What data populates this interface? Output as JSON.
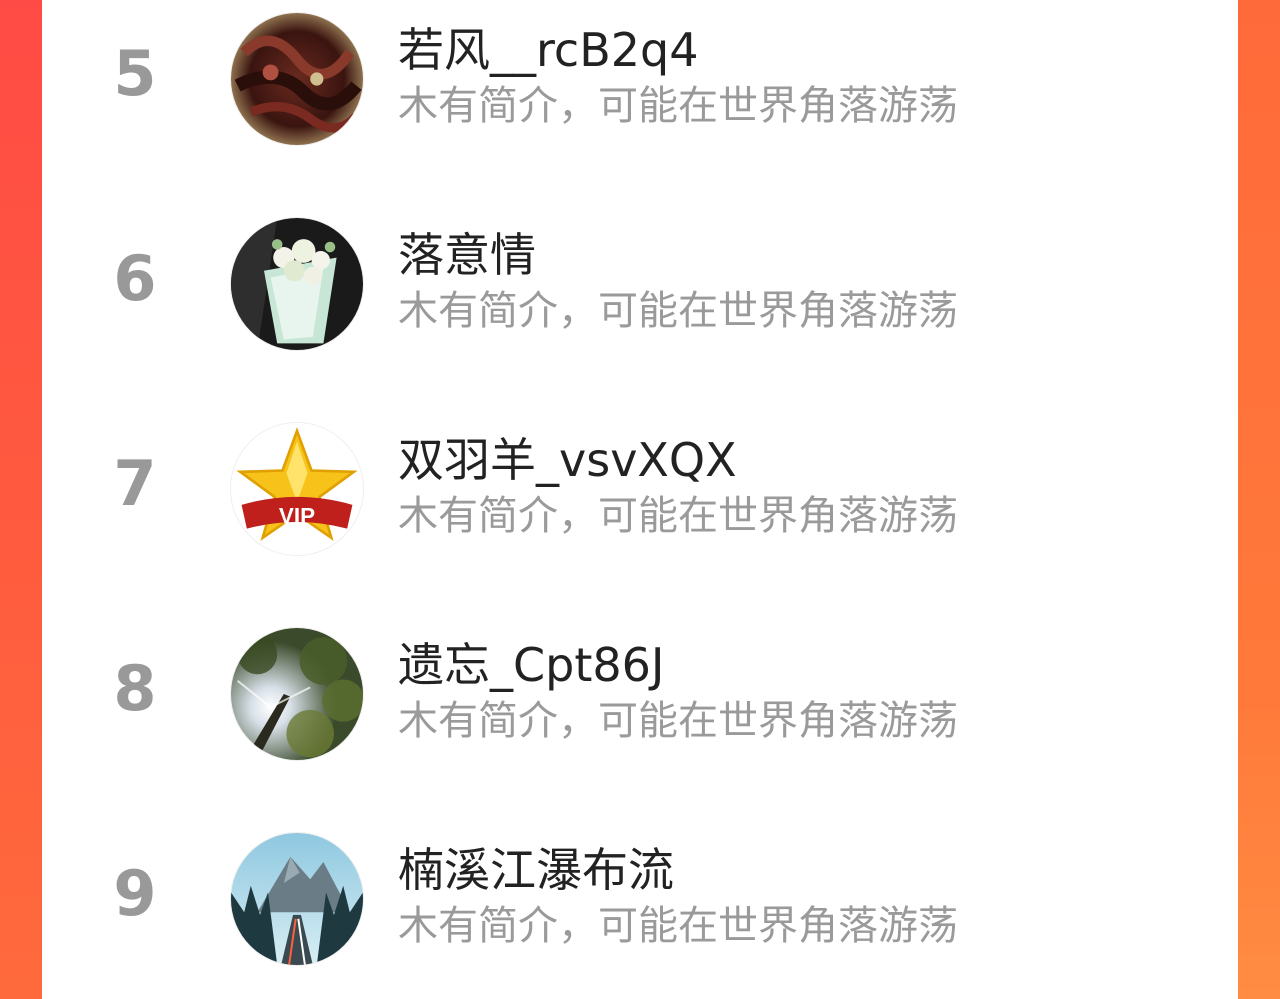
{
  "leaderboard": {
    "entries": [
      {
        "rank": "5",
        "name": "若风__rcB2q4",
        "bio": "木有简介，可能在世界角落游荡",
        "avatar_icon": "dark-art-avatar-icon"
      },
      {
        "rank": "6",
        "name": "落意情",
        "bio": "木有简介，可能在世界角落游荡",
        "avatar_icon": "flower-bouquet-avatar-icon"
      },
      {
        "rank": "7",
        "name": "双羽羊_vsvXQX",
        "bio": "木有简介，可能在世界角落游荡",
        "avatar_icon": "vip-star-avatar-icon"
      },
      {
        "rank": "8",
        "name": "遗忘_Cpt86J",
        "bio": "木有简介，可能在世界角落游荡",
        "avatar_icon": "tree-sunlight-avatar-icon"
      },
      {
        "rank": "9",
        "name": "楠溪江瀑布流",
        "bio": "木有简介，可能在世界角落游荡",
        "avatar_icon": "mountain-road-avatar-icon"
      }
    ]
  },
  "colors": {
    "background_left": "#ff4b45",
    "background_right": "#ff7a3a",
    "rank_text": "#999999",
    "name_text": "#222222",
    "bio_text": "#9a9a9a"
  }
}
